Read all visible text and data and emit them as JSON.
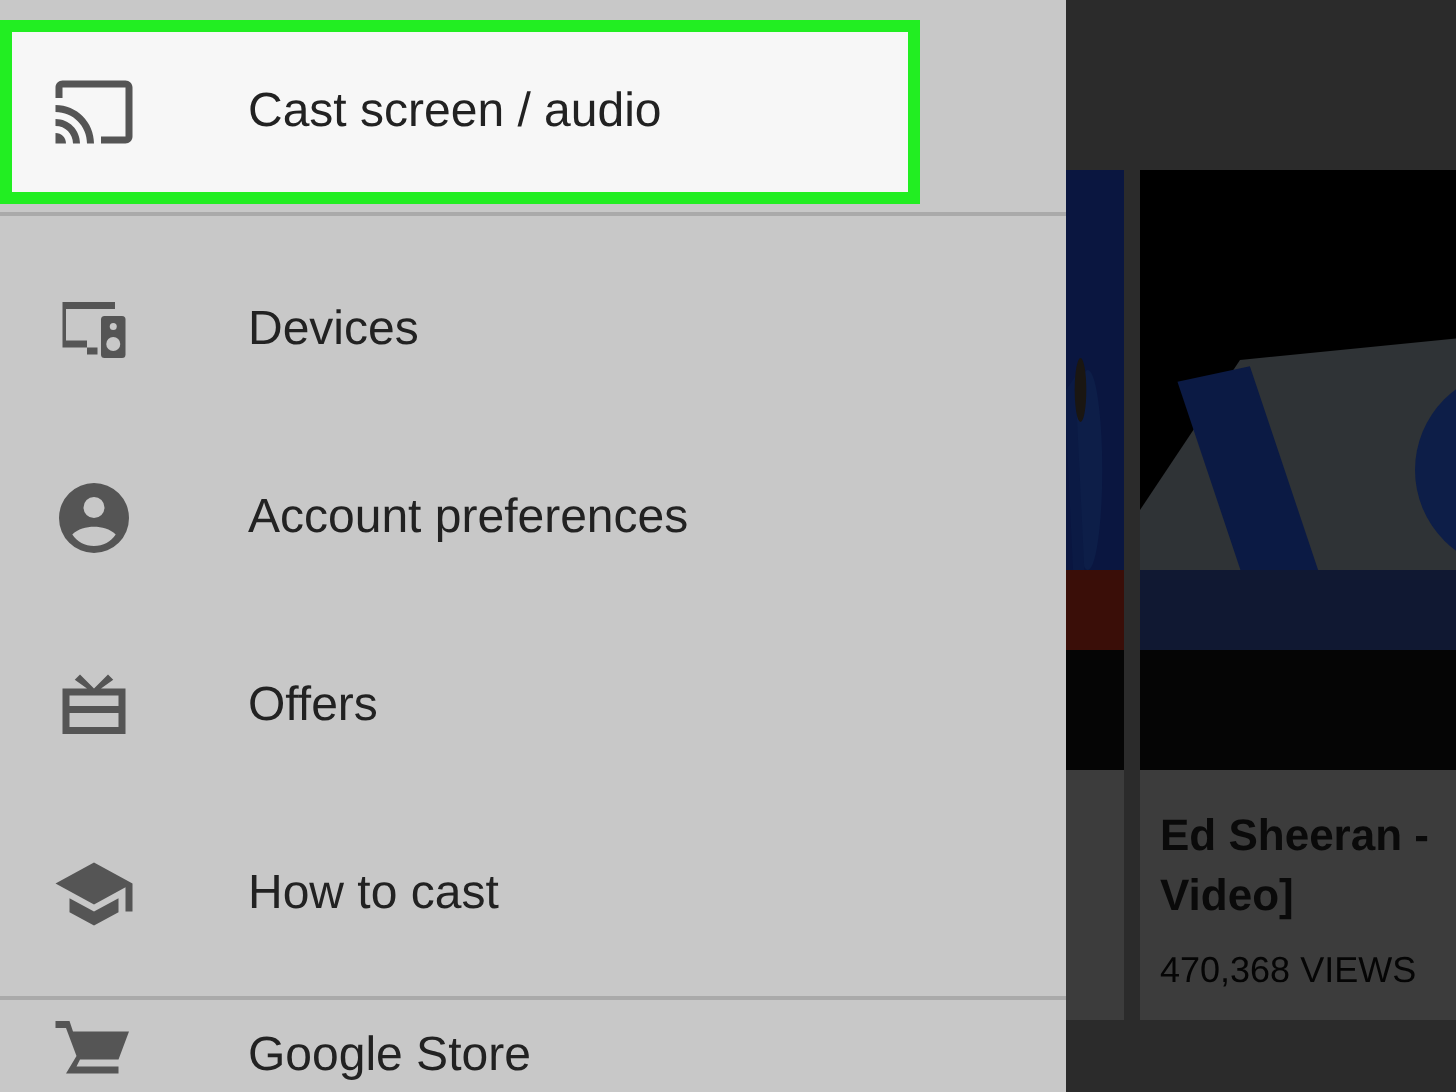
{
  "drawer": {
    "sections": [
      {
        "items": [
          {
            "kind": "cast",
            "label": "Cast screen / audio",
            "selected": true
          }
        ]
      },
      {
        "items": [
          {
            "kind": "devices",
            "label": "Devices",
            "selected": false
          },
          {
            "kind": "account",
            "label": "Account preferences",
            "selected": false
          },
          {
            "kind": "offers",
            "label": "Offers",
            "selected": false
          },
          {
            "kind": "learn",
            "label": "How to cast",
            "selected": false
          }
        ]
      },
      {
        "items": [
          {
            "kind": "store",
            "label": "Google Store",
            "selected": false
          }
        ]
      }
    ]
  },
  "videos": [
    {
      "kind": "picture"
    },
    {
      "kind": "picture",
      "title": "Ed Sheeran -\nVideo]",
      "views": "470,368 VIEWS"
    }
  ]
}
